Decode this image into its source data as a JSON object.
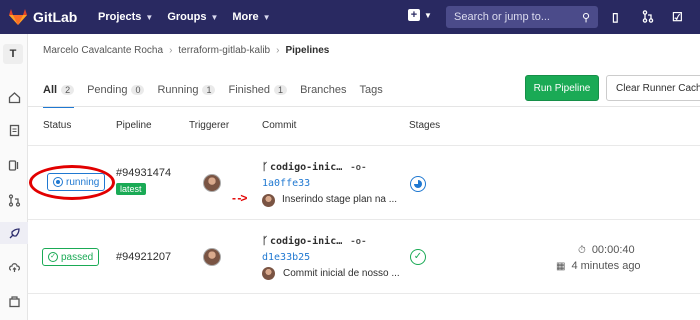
{
  "topbar": {
    "brand": "GitLab",
    "nav": [
      "Projects",
      "Groups",
      "More"
    ],
    "search_placeholder": "Search or jump to...",
    "icons": [
      "plus-icon",
      "search-icon",
      "issues-icon",
      "merge-request-icon",
      "todo-icon"
    ]
  },
  "sidebar": {
    "project_initial": "T",
    "items": [
      "home-icon",
      "repository-icon",
      "issues-icon",
      "merge-request-icon",
      "ci-cd-icon",
      "operations-icon",
      "packages-icon"
    ]
  },
  "breadcrumb": {
    "items": [
      "Marcelo Cavalcante Rocha",
      "terraform-gitlab-kalib",
      "Pipelines"
    ]
  },
  "tabs": [
    {
      "label": "All",
      "count": "2"
    },
    {
      "label": "Pending",
      "count": "0"
    },
    {
      "label": "Running",
      "count": "1"
    },
    {
      "label": "Finished",
      "count": "1"
    },
    {
      "label": "Branches",
      "count": ""
    },
    {
      "label": "Tags",
      "count": ""
    }
  ],
  "actions": {
    "run_pipeline": "Run Pipeline",
    "clear_cache": "Clear Runner Caches"
  },
  "table": {
    "headers": [
      "Status",
      "Pipeline",
      "Triggerer",
      "Commit",
      "Stages"
    ],
    "rows": [
      {
        "status": "running",
        "pipeline_id": "#94931474",
        "tag": "latest",
        "branch": "codigo-inic…",
        "sha": "1a0ffe33",
        "message": "Inserindo stage plan na ...",
        "duration": "",
        "finished": ""
      },
      {
        "status": "passed",
        "pipeline_id": "#94921207",
        "tag": "",
        "branch": "codigo-inic…",
        "sha": "d1e33b25",
        "message": "Commit inicial de nosso ...",
        "duration": "00:00:40",
        "finished": "4 minutes ago"
      }
    ]
  },
  "annotation": {
    "arrow": "- ->",
    "color": "#e20000"
  },
  "colors": {
    "navbar": "#292961",
    "running": "#1f78d1",
    "passed": "#1aaa55"
  }
}
